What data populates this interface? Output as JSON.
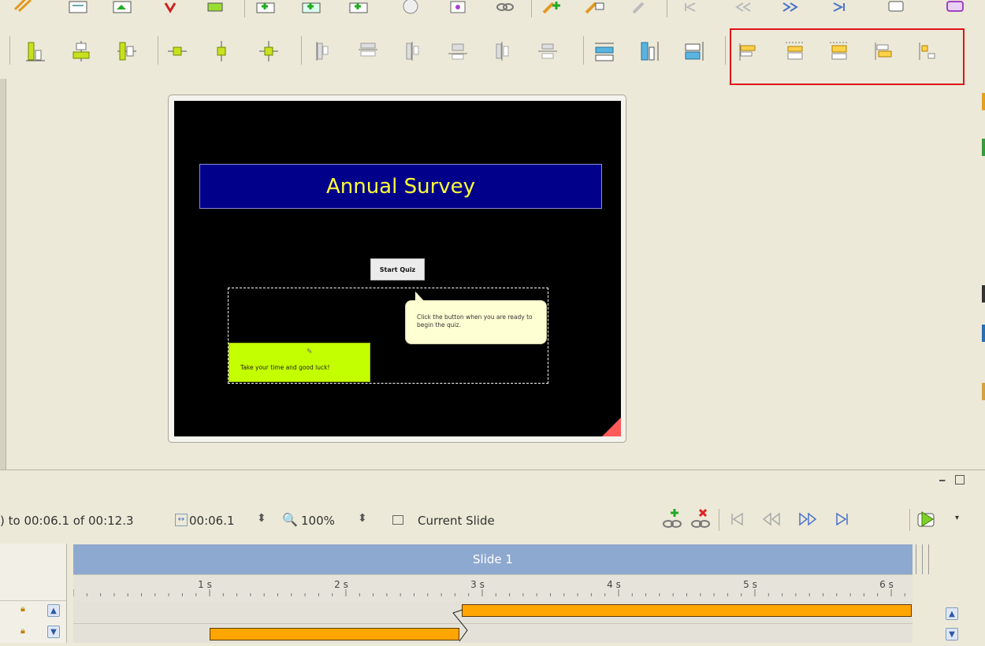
{
  "colors": {
    "accent_highlight": "#e0141a",
    "slide_background": "#000000",
    "title_box": "#00008b",
    "title_text": "#ffff3a",
    "green_caption": "#c4ff00",
    "bubble": "#ffffd4",
    "timeline_bar": "#ffa500",
    "slide_header": "#8ea9cf"
  },
  "toolbar_top": {
    "icons": [
      "cut-icon",
      "copy-icon",
      "paste-icon",
      "delete-icon",
      "insert-icon",
      "add-slide-icon",
      "add-slide-alt-icon",
      "add-slide-copy-icon",
      "record-icon",
      "preview-icon",
      "link-icon",
      "edit-object-icon",
      "edit-image-icon",
      "edit-disabled-icon",
      "rewind-start-icon",
      "rewind-icon",
      "forward-icon",
      "forward-end-icon",
      "publish-icon",
      "library-icon"
    ]
  },
  "toolbar_align": {
    "icons": [
      "align-left-icon",
      "align-center-icon",
      "align-right-icon",
      "distribute-horizontal-icon",
      "distribute-vertical-icon",
      "center-both-icon",
      "align-left-edge-icon",
      "align-center-horizontal-icon",
      "align-right-edge-icon",
      "align-top-icon",
      "align-middle-icon",
      "align-bottom-icon",
      "same-width-icon",
      "same-height-icon",
      "same-size-icon"
    ],
    "highlighted_icons": [
      "order-front-icon",
      "order-forward-icon",
      "order-backward-icon",
      "order-back-icon",
      "order-timing-icon"
    ]
  },
  "slide": {
    "title": "Annual Survey",
    "button_label": "Start Quiz",
    "bubble_text": "Click the button when you are ready to begin the quiz.",
    "green_caption": "Take your time and good luck!"
  },
  "timeline": {
    "range_text": ") to 00:06.1 of 00:12.3",
    "duration": "00:06.1",
    "zoom": "100%",
    "scope_label": "Current Slide",
    "slide_header": "Slide 1",
    "ruler_ticks": [
      "1 s",
      "2 s",
      "3 s",
      "4 s",
      "5 s",
      "6 s"
    ],
    "bars": [
      {
        "start_s": 2.85,
        "end_s": 6.15
      },
      {
        "start_s": 1.0,
        "end_s": 2.83
      }
    ]
  }
}
